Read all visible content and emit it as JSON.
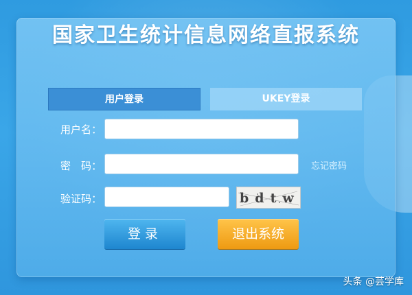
{
  "title": "国家卫生统计信息网络直报系统",
  "tabs": {
    "user_login": "用户登录",
    "ukey_login": "UKEY登录"
  },
  "form": {
    "username_label": "用户名：",
    "username_value": "",
    "password_label": "密　码：",
    "password_value": "",
    "forgot_password": "忘记密码",
    "captcha_label": "验证码：",
    "captcha_value": "",
    "captcha_image_text": "bdtw"
  },
  "buttons": {
    "login": "登录",
    "exit": "退出系统"
  },
  "watermark": "头条 @芸学库",
  "colors": {
    "background": "#3aa6e8",
    "active_tab": "#3b8fd6",
    "login_button": "#1e86cf",
    "exit_button": "#ee9a12"
  }
}
